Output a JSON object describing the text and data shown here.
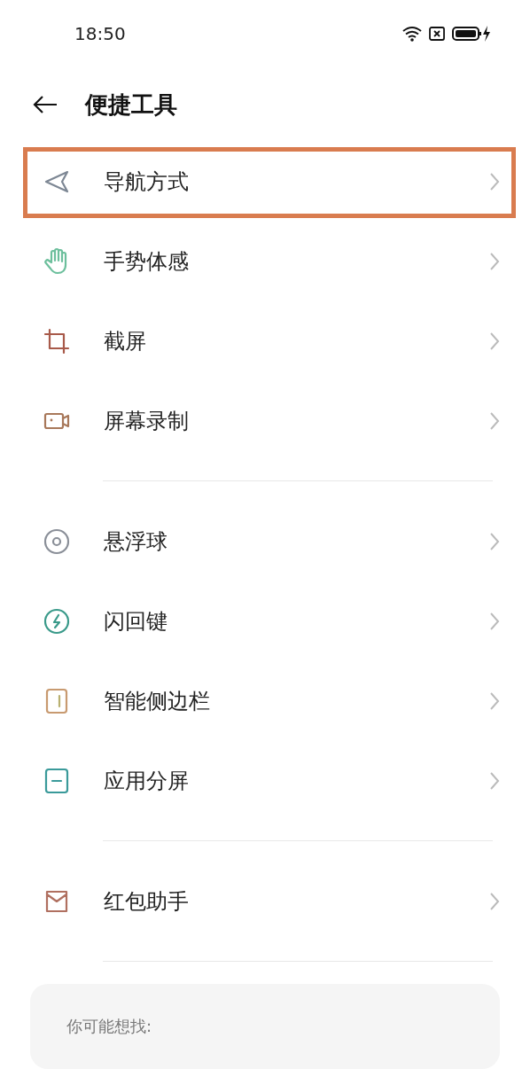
{
  "status_bar": {
    "time": "18:50"
  },
  "header": {
    "title": "便捷工具"
  },
  "groups": [
    {
      "items": [
        {
          "label": "导航方式",
          "kind": "navigation",
          "color": "#7d8794",
          "highlighted": true
        },
        {
          "label": "手势体感",
          "kind": "hand",
          "color": "#6cbf9c",
          "highlighted": false
        },
        {
          "label": "截屏",
          "kind": "crop",
          "color": "#a85a4a",
          "highlighted": false
        },
        {
          "label": "屏幕录制",
          "kind": "camera",
          "color": "#a8785a",
          "highlighted": false
        }
      ]
    },
    {
      "items": [
        {
          "label": "悬浮球",
          "kind": "ball",
          "color": "#8a8f98",
          "highlighted": false
        },
        {
          "label": "闪回键",
          "kind": "flash",
          "color": "#3a9a8a",
          "highlighted": false
        },
        {
          "label": "智能侧边栏",
          "kind": "sidebar",
          "color": "#c89a70",
          "highlighted": false
        },
        {
          "label": "应用分屏",
          "kind": "split",
          "color": "#3a9a9a",
          "highlighted": false
        }
      ]
    },
    {
      "items": [
        {
          "label": "红包助手",
          "kind": "envelope",
          "color": "#b07060",
          "highlighted": false
        }
      ]
    }
  ],
  "suggestions": {
    "title": "你可能想找:"
  }
}
